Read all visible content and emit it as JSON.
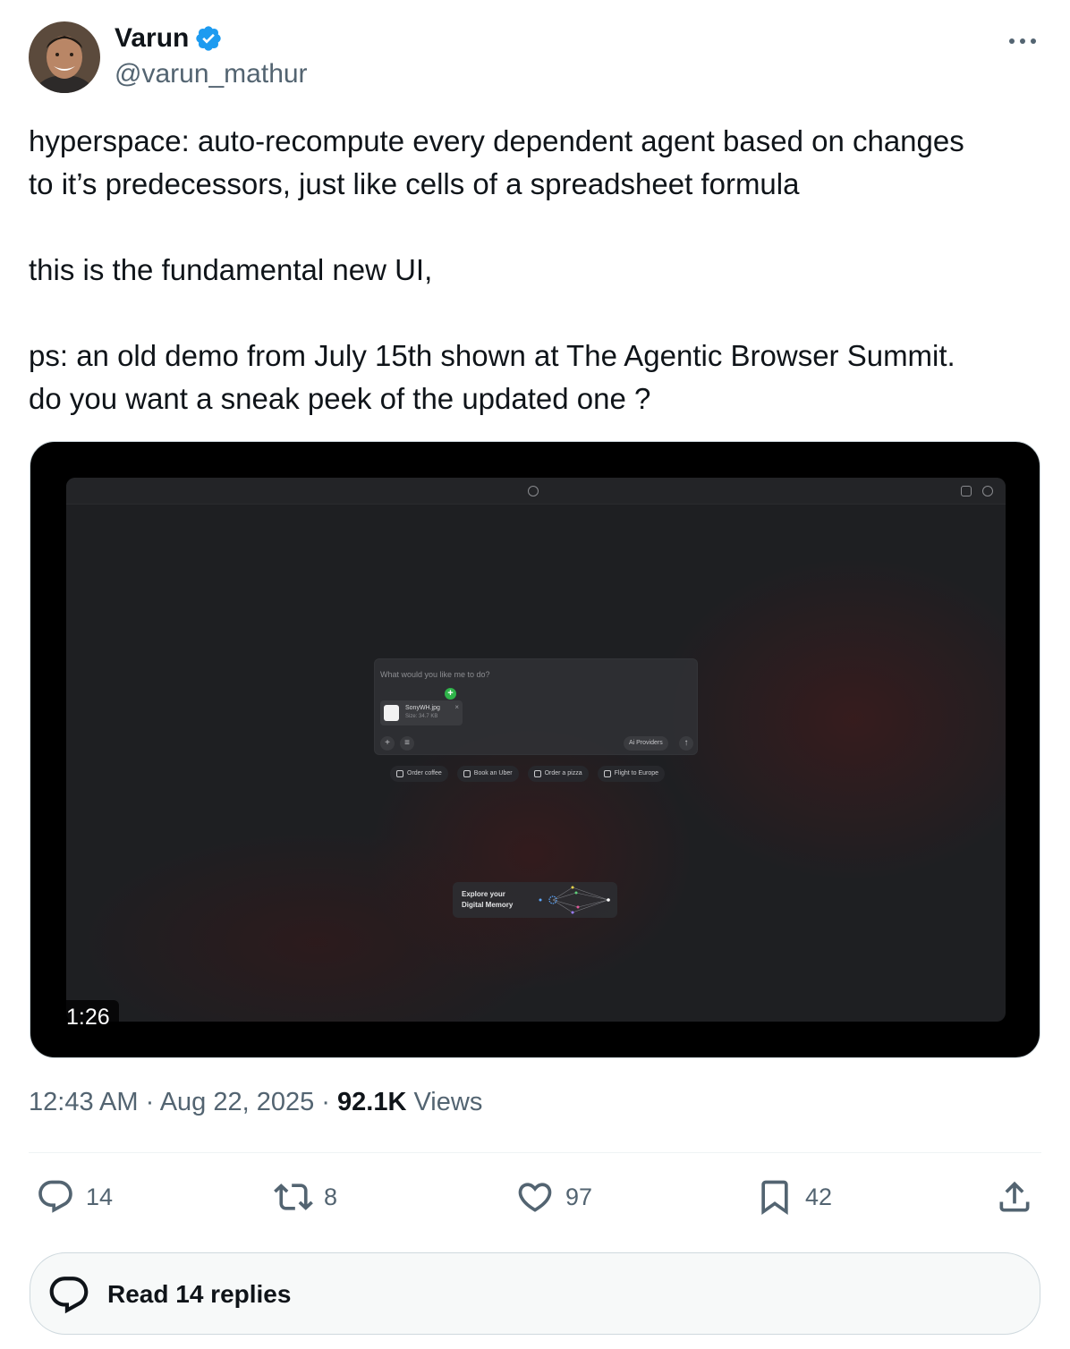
{
  "author": {
    "display_name": "Varun",
    "handle": "@varun_mathur",
    "verified": true,
    "avatar_icon": "avatar-photo"
  },
  "tweet": {
    "lines": [
      "hyperspace: auto-recompute every dependent agent based on changes",
      "to it’s predecessors, just like cells of a spreadsheet formula",
      "this is the fundamental new UI,",
      "ps: an old demo from July 15th shown at The Agentic Browser Summit.",
      "do you want a sneak peek of the updated one ?"
    ]
  },
  "video": {
    "duration": "1:26",
    "app": {
      "prompt_placeholder": "What would you like me to do?",
      "attachment": {
        "name": "SonyWH.jpg",
        "size": "Size: 34.7 KB"
      },
      "providers_label": "Ai Providers",
      "suggestions": [
        "Order coffee",
        "Book an Uber",
        "Order a pizza",
        "Flight to Europe"
      ],
      "memory_line1": "Explore your",
      "memory_line2": "Digital Memory"
    }
  },
  "meta": {
    "time": "12:43 AM",
    "date": "Aug 22, 2025",
    "views_count": "92.1K",
    "views_label": "Views"
  },
  "actions": {
    "replies": "14",
    "reposts": "8",
    "likes": "97",
    "bookmarks": "42"
  },
  "read_replies_label": "Read 14 replies",
  "colors": {
    "text": "#0f1419",
    "secondary": "#536471",
    "verified": "#1d9bf0",
    "border": "#cfd9de"
  }
}
